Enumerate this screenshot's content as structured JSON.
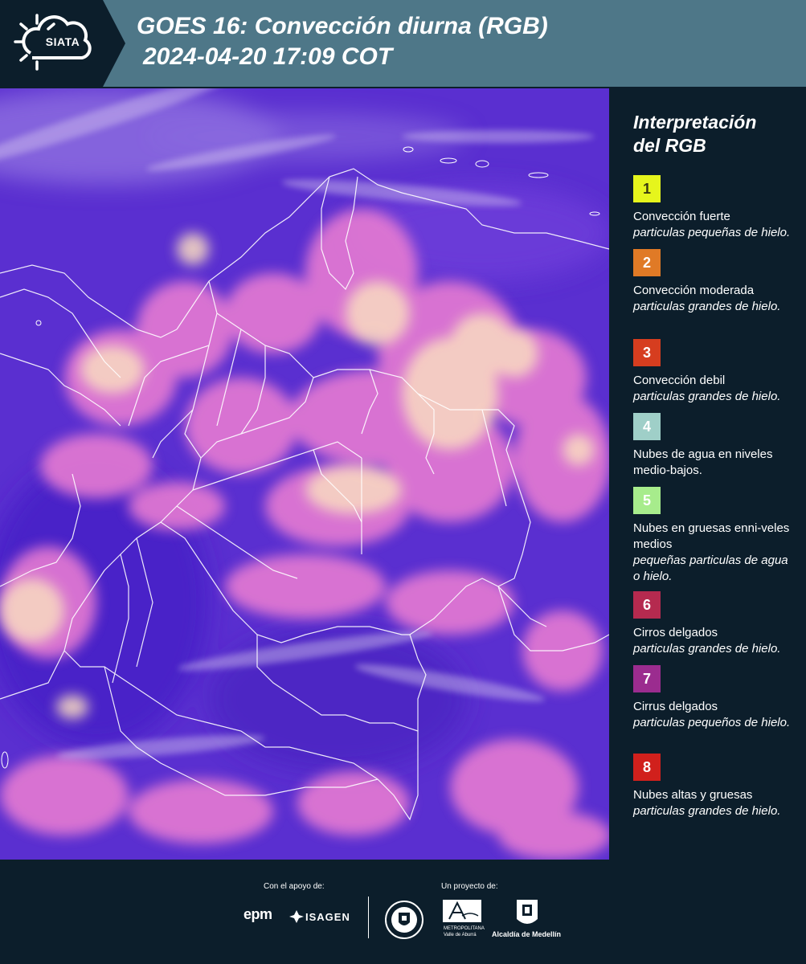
{
  "header": {
    "logo_text": "SIATA",
    "title_line1": "GOES 16: Convección diurna (RGB)",
    "title_line2": "2024-04-20 17:09 COT"
  },
  "legend": {
    "title_line1": "Interpretación",
    "title_line2": "del RGB",
    "items": [
      {
        "number": "1",
        "color": "#e6f51c",
        "text_color": "#3a3a10",
        "label": "Convección fuerte",
        "sub": "particulas pequeñas de hielo."
      },
      {
        "number": "2",
        "color": "#e07a26",
        "text_color": "#ffffff",
        "label": "Convección moderada",
        "sub": "particulas grandes de hielo."
      },
      {
        "number": "3",
        "color": "#d63d1f",
        "text_color": "#ffffff",
        "label": "Convección debil",
        "sub": "particulas grandes de hielo."
      },
      {
        "number": "4",
        "color": "#9fcfc8",
        "text_color": "#ffffff",
        "label": "Nubes de agua en niveles medio-bajos.",
        "sub": ""
      },
      {
        "number": "5",
        "color": "#a7ec8c",
        "text_color": "#ffffff",
        "label": "Nubes en gruesas enni-veles medios",
        "sub": "pequeñas particulas de agua o hielo."
      },
      {
        "number": "6",
        "color": "#b52a4f",
        "text_color": "#ffffff",
        "label": "Cirros delgados",
        "sub": "particulas grandes de hielo."
      },
      {
        "number": "7",
        "color": "#9b2c8f",
        "text_color": "#ffffff",
        "label": "Cirrus delgados",
        "sub": "particulas pequeños de hielo."
      },
      {
        "number": "8",
        "color": "#d1201c",
        "text_color": "#ffffff",
        "label": "Nubes altas y gruesas",
        "sub": "particulas grandes de hielo."
      }
    ]
  },
  "footer": {
    "support_caption": "Con el apoyo de:",
    "project_caption": "Un proyecto de:",
    "epm": "epm",
    "isagen": "ISAGEN",
    "area_caption_1": "METROPOLITANA",
    "area_caption_2": "Valle de Aburrá",
    "alcaldia": "Alcaldía de Medellín"
  },
  "colors": {
    "header_bg": "#4e7788",
    "page_bg": "#0c1e2b",
    "map_base": "#5a2fd0",
    "cloud_pink": "#f08fd0",
    "cloud_yellow": "#f8e6b0",
    "boundary": "#ffffff"
  }
}
